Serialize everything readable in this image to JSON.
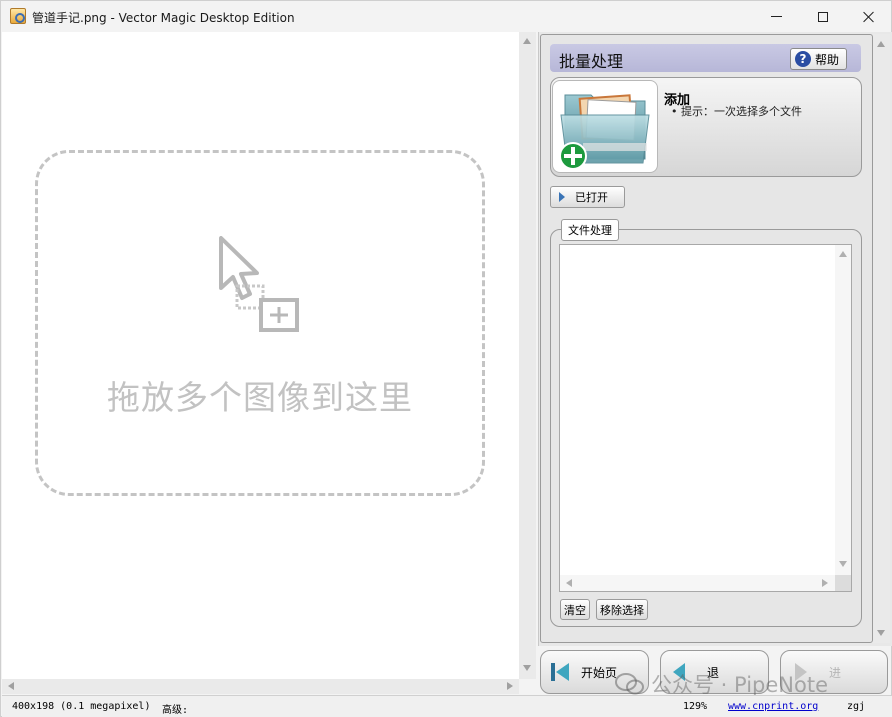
{
  "window": {
    "title": "管道手记.png - Vector Magic Desktop Edition"
  },
  "canvas": {
    "drop_text": "拖放多个图像到这里"
  },
  "batch": {
    "title": "批量处理",
    "help_label": "帮助",
    "add_title": "添加",
    "add_hint": "• 提示：一次选择多个文件",
    "opened_label": "已打开",
    "group_label": "文件处理",
    "clear_label": "清空",
    "remove_label": "移除选择"
  },
  "nav": {
    "start_label": "开始页",
    "back_label": "退",
    "next_label": "进"
  },
  "status": {
    "dimensions": "400x198 (0.1 megapixel)",
    "advanced": "高级:",
    "zoom": "129%",
    "url": "www.cnprint.org",
    "user": "zgj"
  },
  "watermark": {
    "text": "公众号 · PipeNote"
  },
  "icons": {
    "app": "vector-magic-icon",
    "help": "question-icon",
    "folder": "folder-add-icon",
    "drop": "cursor-drop-icon",
    "start": "start-page-icon",
    "back": "back-arrow-icon",
    "next": "next-arrow-icon"
  }
}
